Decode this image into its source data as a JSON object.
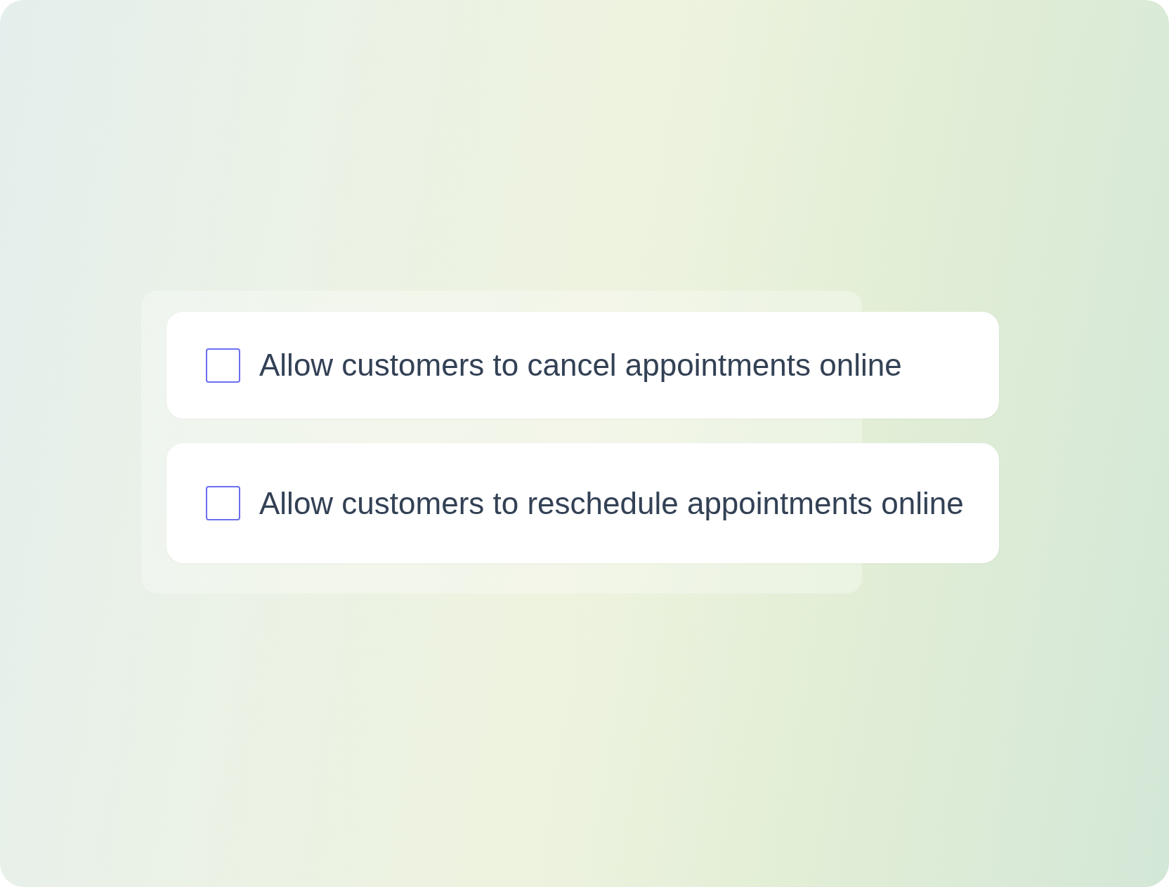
{
  "options": [
    {
      "label": "Allow customers to cancel appointments online",
      "checked": false
    },
    {
      "label": "Allow customers to reschedule appointments online",
      "checked": false
    }
  ]
}
